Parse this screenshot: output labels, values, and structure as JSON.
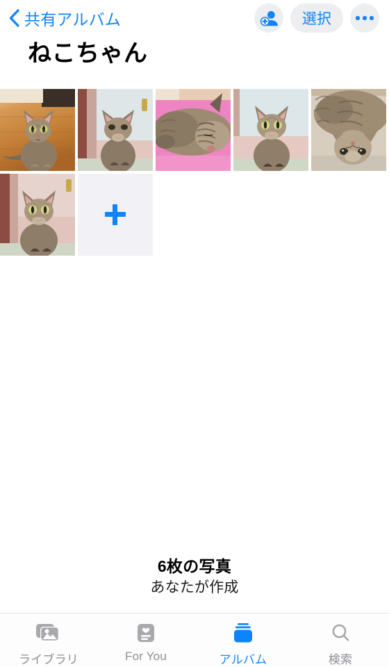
{
  "navbar": {
    "back_icon": "chevron-left-icon",
    "back_label": "共有アルバム",
    "add_people_icon": "add-person-icon",
    "select_label": "選択",
    "more_icon": "ellipsis-icon"
  },
  "album": {
    "title": "ねこちゃん",
    "photo_count_text": "6枚の写真",
    "owner_text": "あなたが作成"
  },
  "grid": {
    "add_tile_icon": "plus-icon",
    "photos": [
      {
        "alt": "tabby-cat-sitting-on-wooden-floor"
      },
      {
        "alt": "tabby-cat-looking-up-by-pink-wall"
      },
      {
        "alt": "tabby-cat-sleeping-on-pink-blanket"
      },
      {
        "alt": "tabby-cat-sitting-facing-camera"
      },
      {
        "alt": "tabby-cat-lying-upside-down"
      },
      {
        "alt": "tabby-cat-sitting-by-pink-wall"
      }
    ]
  },
  "tabbar": {
    "tabs": [
      {
        "id": "library",
        "label": "ライブラリ",
        "icon": "photo-stack-icon",
        "active": false
      },
      {
        "id": "for-you",
        "label": "For You",
        "icon": "for-you-card-icon",
        "active": false
      },
      {
        "id": "albums",
        "label": "アルバム",
        "icon": "albums-stack-icon",
        "active": true
      },
      {
        "id": "search",
        "label": "検索",
        "icon": "magnifier-icon",
        "active": false
      }
    ]
  },
  "colors": {
    "accent": "#1283fb",
    "inactive": "#8e8e93",
    "control_bg": "#eceef0",
    "add_tile_bg": "#f2f2f6"
  }
}
